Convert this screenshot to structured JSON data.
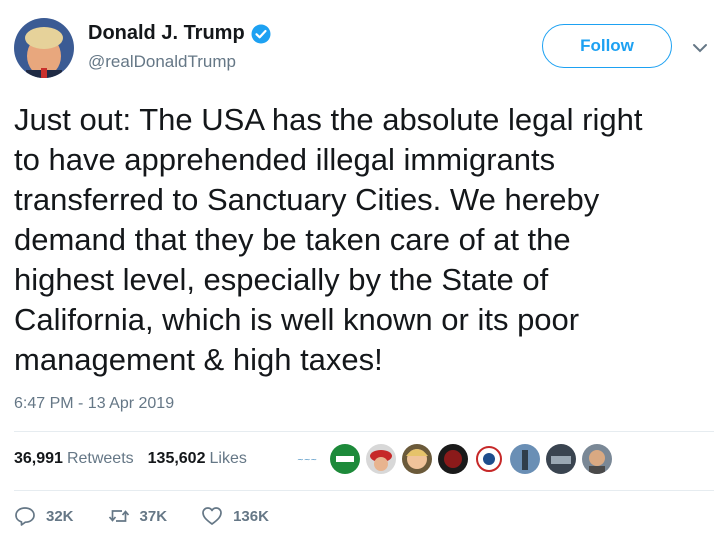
{
  "user": {
    "display_name": "Donald J. Trump",
    "handle": "@realDonaldTrump",
    "verified": true
  },
  "follow_label": "Follow",
  "tweet": {
    "text": "Just out: The USA has the absolute legal right\nto have apprehended illegal immigrants\ntransferred to Sanctuary Cities. We hereby\ndemand that they be taken care of at the\nhighest level, especially by the State of\nCalifornia, which is well known or its poor\nmanagement & high taxes!",
    "timestamp": "6:47 PM - 13 Apr 2019"
  },
  "stats": {
    "retweets_count": "36,991",
    "retweets_label": "Retweets",
    "likes_count": "135,602",
    "likes_label": "Likes"
  },
  "actions": {
    "reply_count": "32K",
    "retweet_count": "37K",
    "like_count": "136K"
  },
  "colors": {
    "accent": "#1da1f2",
    "text": "#14171a",
    "muted": "#657786",
    "divider": "#e6ecf0"
  }
}
